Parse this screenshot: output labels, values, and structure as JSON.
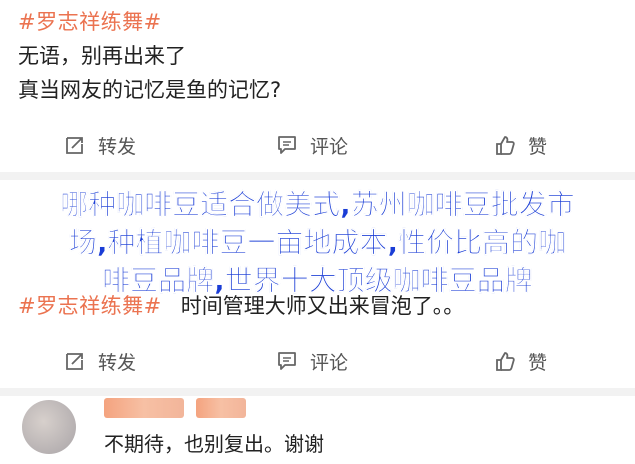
{
  "post1": {
    "hashtag": "#罗志祥练舞#",
    "line1": "无语，别再出来了",
    "line2": "真当网友的记忆是鱼的记忆?"
  },
  "actions1": {
    "repost": "转发",
    "comment": "评论",
    "like": "赞"
  },
  "overlay": {
    "line1": "哪种咖啡豆适合做美式,苏州咖啡豆批发市",
    "line2": "场,种植咖啡豆一亩地成本,性价比高的咖",
    "line3": "啡豆品牌,世界十大顶级咖啡豆品牌"
  },
  "post2": {
    "hashtag": "#罗志祥练舞#",
    "text": "时间管理大师又出来冒泡了。。"
  },
  "actions2": {
    "repost": "转发",
    "comment": "评论",
    "like": "赞"
  },
  "comment": {
    "text": "不期待，也别复出。谢谢"
  },
  "icons": {
    "repost": "repost-icon",
    "comment": "comment-icon",
    "like": "thumbs-up-icon"
  },
  "colors": {
    "hashtag": "#eb7350",
    "overlay_text": "#1a3dd6",
    "action_text": "#555555",
    "divider": "#f2f2f2"
  }
}
